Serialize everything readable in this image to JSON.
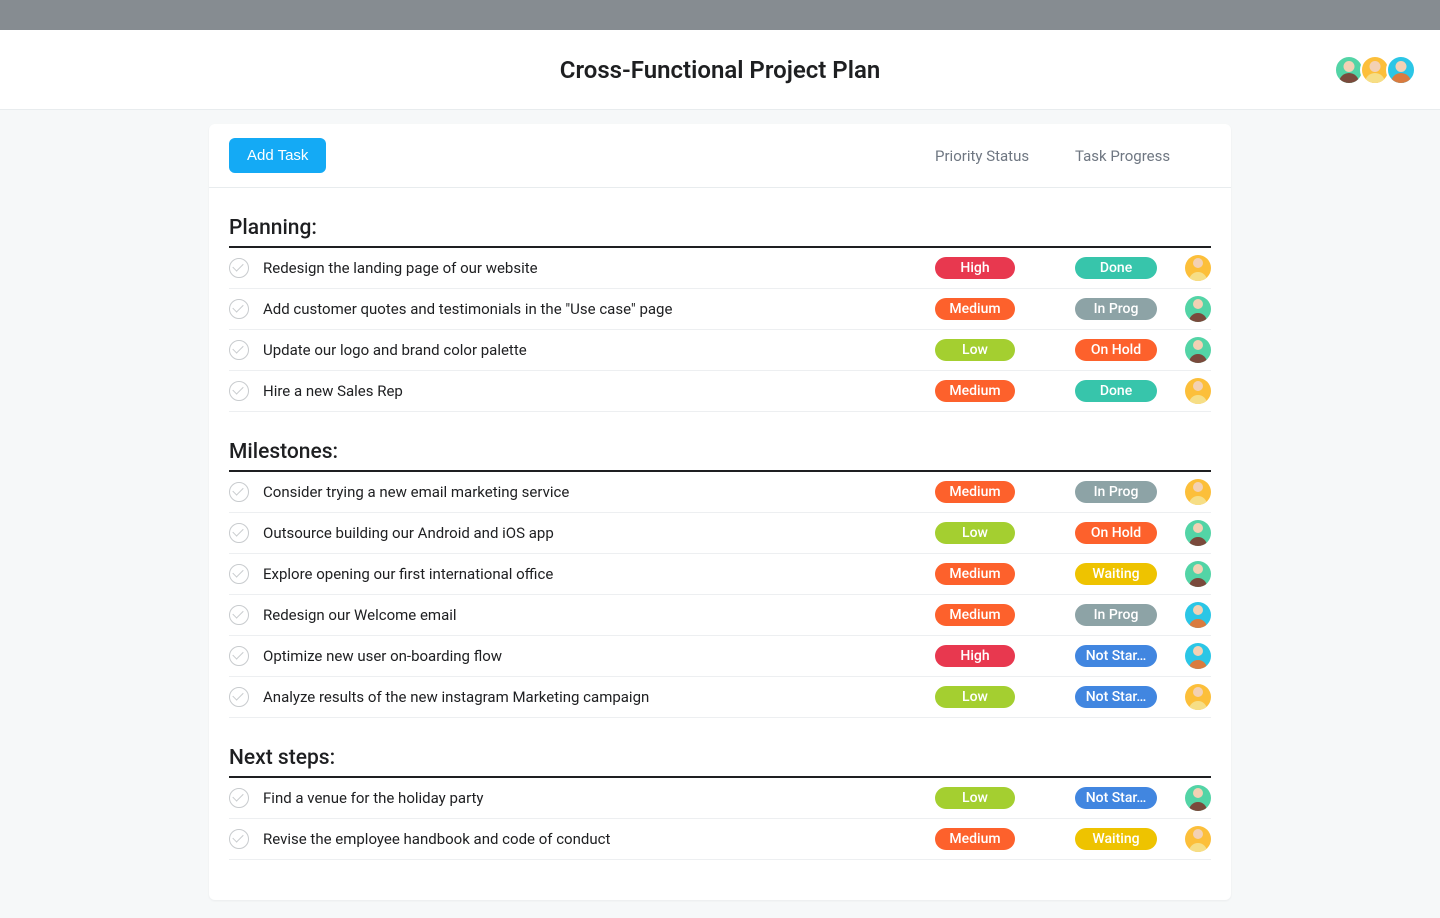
{
  "header": {
    "title": "Cross-Functional Project Plan",
    "avatars": [
      "green",
      "orange",
      "cyan"
    ]
  },
  "toolbar": {
    "add_task_label": "Add Task",
    "col_priority": "Priority Status",
    "col_progress": "Task Progress"
  },
  "priority_colors": {
    "High": "#e8384f",
    "Medium": "#fd612c",
    "Low": "#a4cf30"
  },
  "progress_colors": {
    "Done": "#37c5ab",
    "In Prog": "#8da3a6",
    "On Hold": "#fd612c",
    "Waiting": "#eec300",
    "Not Star…": "#4186e0"
  },
  "avatar_class": {
    "green": "avatar-green av-green",
    "orange": "avatar-orange av-orange",
    "cyan": "avatar-cyan av-cyan"
  },
  "sections": [
    {
      "title": "Planning:",
      "tasks": [
        {
          "title": "Redesign the landing page of our website",
          "priority": "High",
          "progress": "Done",
          "assignee": "orange"
        },
        {
          "title": "Add customer quotes and testimonials in the \"Use case\" page",
          "priority": "Medium",
          "progress": "In Prog",
          "assignee": "green"
        },
        {
          "title": "Update our logo and brand color palette",
          "priority": "Low",
          "progress": "On Hold",
          "assignee": "green"
        },
        {
          "title": "Hire a new Sales Rep",
          "priority": "Medium",
          "progress": "Done",
          "assignee": "orange"
        }
      ]
    },
    {
      "title": "Milestones:",
      "tasks": [
        {
          "title": "Consider trying a new email marketing service",
          "priority": "Medium",
          "progress": "In Prog",
          "assignee": "orange"
        },
        {
          "title": "Outsource building our Android and iOS app",
          "priority": "Low",
          "progress": "On Hold",
          "assignee": "green"
        },
        {
          "title": "Explore opening our first international office",
          "priority": "Medium",
          "progress": "Waiting",
          "assignee": "green"
        },
        {
          "title": "Redesign our Welcome email",
          "priority": "Medium",
          "progress": "In Prog",
          "assignee": "cyan"
        },
        {
          "title": "Optimize new user on-boarding flow",
          "priority": "High",
          "progress": "Not Star…",
          "assignee": "cyan"
        },
        {
          "title": "Analyze results of the new instagram Marketing campaign",
          "priority": "Low",
          "progress": "Not Star…",
          "assignee": "orange"
        }
      ]
    },
    {
      "title": "Next steps:",
      "tasks": [
        {
          "title": "Find a venue for the holiday party",
          "priority": "Low",
          "progress": "Not Star…",
          "assignee": "green"
        },
        {
          "title": "Revise the employee handbook and code of conduct",
          "priority": "Medium",
          "progress": "Waiting",
          "assignee": "orange"
        }
      ]
    }
  ]
}
